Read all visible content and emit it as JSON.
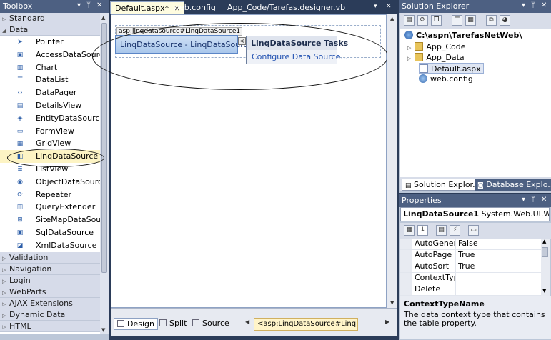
{
  "toolbox": {
    "title": "Toolbox",
    "categories_top": [
      {
        "label": "Standard",
        "expanded": false
      },
      {
        "label": "Data",
        "expanded": true
      }
    ],
    "data_items": [
      {
        "label": "Pointer",
        "icon": "pointer-icon",
        "glyph": "➤"
      },
      {
        "label": "AccessDataSource",
        "icon": "access-datasource-icon",
        "glyph": "▣"
      },
      {
        "label": "Chart",
        "icon": "chart-icon",
        "glyph": "▥"
      },
      {
        "label": "DataList",
        "icon": "datalist-icon",
        "glyph": "☰"
      },
      {
        "label": "DataPager",
        "icon": "datapager-icon",
        "glyph": "‹›"
      },
      {
        "label": "DetailsView",
        "icon": "detailsview-icon",
        "glyph": "▤"
      },
      {
        "label": "EntityDataSource",
        "icon": "entity-datasource-icon",
        "glyph": "◈"
      },
      {
        "label": "FormView",
        "icon": "formview-icon",
        "glyph": "▭"
      },
      {
        "label": "GridView",
        "icon": "gridview-icon",
        "glyph": "▦"
      },
      {
        "label": "LinqDataSource",
        "icon": "linq-datasource-icon",
        "glyph": "◧"
      },
      {
        "label": "ListView",
        "icon": "listview-icon",
        "glyph": "≣"
      },
      {
        "label": "ObjectDataSource",
        "icon": "object-datasource-icon",
        "glyph": "◉"
      },
      {
        "label": "Repeater",
        "icon": "repeater-icon",
        "glyph": "⟳"
      },
      {
        "label": "QueryExtender",
        "icon": "query-extender-icon",
        "glyph": "◫"
      },
      {
        "label": "SiteMapDataSou...",
        "icon": "sitemap-datasource-icon",
        "glyph": "⊞"
      },
      {
        "label": "SqlDataSource",
        "icon": "sql-datasource-icon",
        "glyph": "▣"
      },
      {
        "label": "XmlDataSource",
        "icon": "xml-datasource-icon",
        "glyph": "◪"
      }
    ],
    "categories_bottom": [
      {
        "label": "Validation"
      },
      {
        "label": "Navigation"
      },
      {
        "label": "Login"
      },
      {
        "label": "WebParts"
      },
      {
        "label": "AJAX Extensions"
      },
      {
        "label": "Dynamic Data"
      },
      {
        "label": "HTML"
      }
    ]
  },
  "document": {
    "tabs": [
      {
        "label": "Default.aspx*",
        "active": true
      },
      {
        "label": "web.config",
        "active": false
      },
      {
        "label": "App_Code/Tarefas.designer.vb",
        "active": false
      }
    ],
    "control_tag": "asp:linqdatasource#LinqDataSource1",
    "control_label": "LinqDataSource",
    "control_id": "LinqDataSource1",
    "control_separator": " - ",
    "smart_tag_glyph": "<",
    "tasks_title": "LinqDataSource Tasks",
    "tasks_link": "Configure Data Source..."
  },
  "bottombar": {
    "design": "Design",
    "split": "Split",
    "source": "Source",
    "breadcrumb": "<asp:LinqDataSource#LinqD...>"
  },
  "solution": {
    "title": "Solution Explorer",
    "tree": [
      {
        "label": "C:\\aspn\\TarefasNetWeb\\",
        "icon": "website-icon"
      },
      {
        "label": "App_Code",
        "icon": "folder-icon"
      },
      {
        "label": "App_Data",
        "icon": "folder-icon"
      },
      {
        "label": "Default.aspx",
        "icon": "aspx-file-icon"
      },
      {
        "label": "web.config",
        "icon": "config-file-icon"
      }
    ],
    "tab_solution": "Solution Explor...",
    "tab_database": "Database Explo..."
  },
  "properties": {
    "title": "Properties",
    "object_name": "LinqDataSource1",
    "object_type": "System.Web.UI.WebC",
    "rows": [
      {
        "name": "AutoGenerateWl",
        "value": "False"
      },
      {
        "name": "AutoPage",
        "value": "True"
      },
      {
        "name": "AutoSort",
        "value": "True"
      },
      {
        "name": "ContextTypeNar",
        "value": ""
      },
      {
        "name": "Delete",
        "value": ""
      }
    ],
    "desc_title": "ContextTypeName",
    "desc_text": "The data context type that contains the table property."
  },
  "colors": {
    "title_bar": "#4d6082",
    "background": "#2b3c59",
    "selection": "#a9c7ec"
  }
}
